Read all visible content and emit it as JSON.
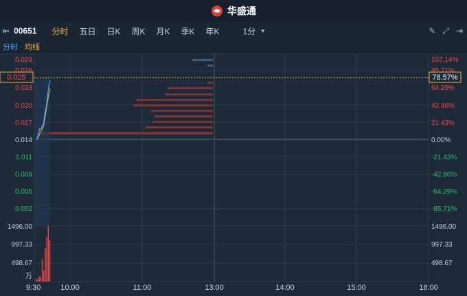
{
  "app": {
    "name": "华盛通"
  },
  "toolbar": {
    "symbol": "00651",
    "tabs": [
      "分时",
      "五日",
      "日K",
      "周K",
      "月K",
      "季K",
      "年K"
    ],
    "active_tab": "分时",
    "period": "1分"
  },
  "indicators": {
    "a": "分时",
    "b": "均线"
  },
  "price_labels_left": [
    "0.029",
    "0.026",
    "0.023",
    "0.020",
    "0.017",
    "0.014",
    "0.011",
    "0.008",
    "0.005",
    "0.002"
  ],
  "pct_labels_right": [
    "107.14%",
    "85.71%",
    "64.29%",
    "42.86%",
    "21.43%",
    "0.00%",
    "-21.43%",
    "-42.86%",
    "-64.29%",
    "-85.71%"
  ],
  "current": {
    "price": "0.025",
    "pct": "78.57%"
  },
  "volume_labels_left": [
    "1496.00",
    "997.33",
    "498.67",
    "万"
  ],
  "volume_labels_right": [
    "1496.00",
    "997.33",
    "498.67"
  ],
  "time_labels": [
    "9:30",
    "10:00",
    "11:00",
    "13:00",
    "14:00",
    "15:00",
    "16:00"
  ],
  "colors": {
    "bg": "#1e2a38",
    "grid": "#2b3a4b",
    "up": "#f04848",
    "down": "#2bbf6a",
    "price_line": "#4aa5ff",
    "avg_line": "#f3b23a",
    "highlight": "#f3b23a"
  },
  "chart_data": {
    "type": "line",
    "y_range": [
      0.0,
      0.029
    ],
    "base": 0.014,
    "price": [
      0.014,
      0.014,
      0.015,
      0.016,
      0.016,
      0.0165,
      0.017,
      0.019,
      0.02,
      0.022,
      0.024,
      0.025
    ],
    "avg": [
      0.014,
      0.014,
      0.0145,
      0.015,
      0.0155,
      0.016,
      0.0165,
      0.018,
      0.0195,
      0.021,
      0.0225,
      0.0235
    ],
    "volume": [
      80,
      60,
      140,
      120,
      600,
      300,
      900,
      1200,
      1496,
      1100
    ]
  }
}
